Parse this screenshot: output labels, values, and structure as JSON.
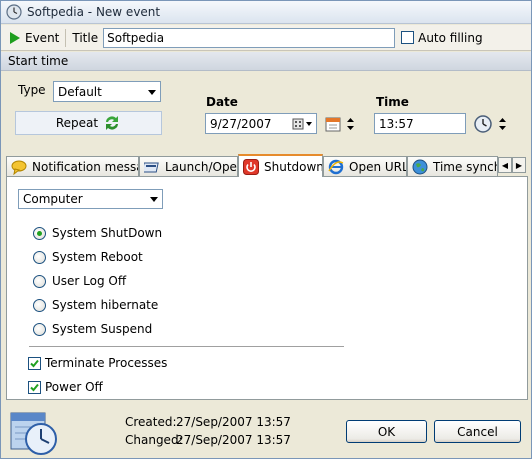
{
  "window": {
    "title": "Softpedia - New event"
  },
  "toolbar": {
    "event_label": "Event",
    "title_label": "Title",
    "title_value": "Softpedia",
    "auto_filling_label": "Auto filling",
    "auto_filling_checked": false
  },
  "start_time": {
    "header": "Start time",
    "type_label": "Type",
    "type_value": "Default",
    "repeat_label": "Repeat",
    "date_label": "Date",
    "date_value": "9/27/2007",
    "time_label": "Time",
    "time_value": "13:57"
  },
  "tabs": [
    {
      "label": "Notification message",
      "icon": "message-icon",
      "active": false
    },
    {
      "label": "Launch/Open",
      "icon": "launch-icon",
      "active": false
    },
    {
      "label": "Shutdown",
      "icon": "power-icon",
      "active": true
    },
    {
      "label": "Open URL",
      "icon": "ie-icon",
      "active": false
    },
    {
      "label": "Time synchro",
      "icon": "globe-icon",
      "active": false
    }
  ],
  "shutdown": {
    "target_value": "Computer",
    "options": [
      {
        "label": "System ShutDown",
        "selected": true
      },
      {
        "label": "System Reboot",
        "selected": false
      },
      {
        "label": "User Log Off",
        "selected": false
      },
      {
        "label": "System hibernate",
        "selected": false
      },
      {
        "label": "System Suspend",
        "selected": false
      }
    ],
    "terminate_label": "Terminate Processes",
    "terminate_checked": true,
    "power_off_label": "Power Off",
    "power_off_checked": true
  },
  "footer": {
    "created_label": "Created:",
    "created_value": "27/Sep/2007  13:57",
    "changed_label": "Changed:",
    "changed_value": "27/Sep/2007  13:57",
    "ok_label": "OK",
    "cancel_label": "Cancel"
  },
  "colors": {
    "accent_tab": "#e68b2c",
    "radio_dot": "#21a121",
    "play_green": "#1e9e1e"
  }
}
